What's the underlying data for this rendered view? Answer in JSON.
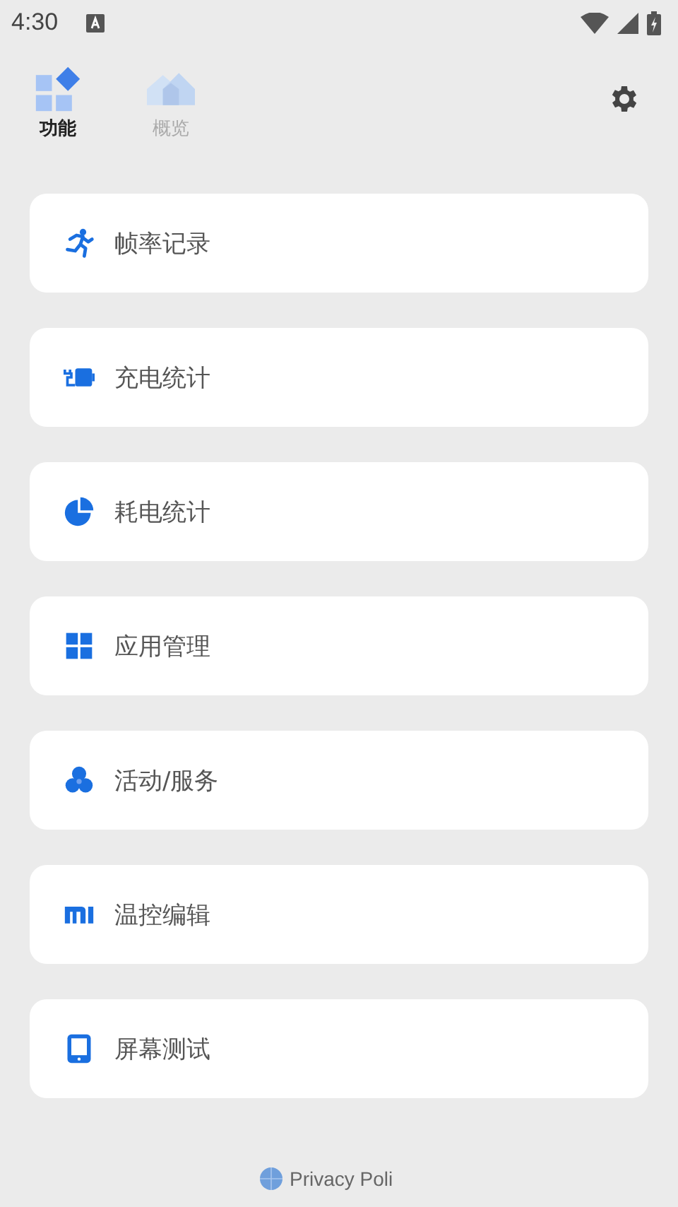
{
  "status_bar": {
    "time": "4:30"
  },
  "tabs": [
    {
      "kind": "features",
      "label": "功能",
      "selected": true
    },
    {
      "kind": "overview",
      "label": "概览",
      "selected": false
    }
  ],
  "items": [
    {
      "kind": "run",
      "label": "帧率记录"
    },
    {
      "kind": "charge",
      "label": "充电统计"
    },
    {
      "kind": "pie",
      "label": "耗电统计"
    },
    {
      "kind": "apps",
      "label": "应用管理"
    },
    {
      "kind": "circles",
      "label": "活动/服务"
    },
    {
      "kind": "logo",
      "label": "温控编辑"
    },
    {
      "kind": "screen",
      "label": "屏幕测试"
    }
  ],
  "footer": {
    "link": "Privacy Poli"
  }
}
